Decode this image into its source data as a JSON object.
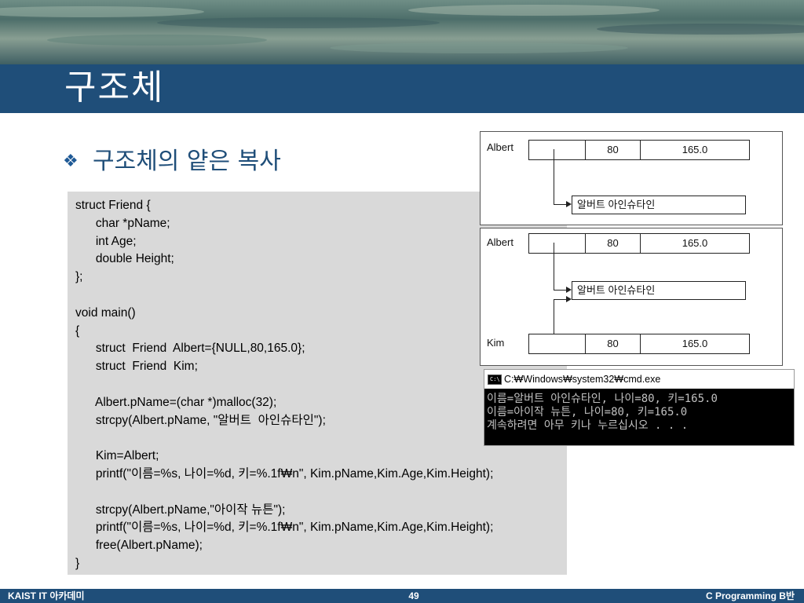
{
  "slide": {
    "title": "구조체",
    "bullet_symbol": "❖",
    "subtitle": "구조체의 얕은 복사"
  },
  "code": [
    "struct Friend {",
    "      char *pName;",
    "      int Age;",
    "      double Height;",
    "};",
    "",
    "void main()",
    "{",
    "      struct  Friend  Albert={NULL,80,165.0};",
    "      struct  Friend  Kim;",
    "",
    "      Albert.pName=(char *)malloc(32);",
    "      strcpy(Albert.pName, \"알버트  아인슈타인\");",
    "",
    "      Kim=Albert;",
    "      printf(\"이름=%s, 나이=%d, 키=%.1f₩n\", Kim.pName,Kim.Age,Kim.Height);",
    "",
    "      strcpy(Albert.pName,\"아이작 뉴튼\");",
    "      printf(\"이름=%s, 나이=%d, 키=%.1f₩n\", Kim.pName,Kim.Age,Kim.Height);",
    "      free(Albert.pName);",
    "}"
  ],
  "diagram1": {
    "var_label": "Albert",
    "age": "80",
    "height": "165.0",
    "name_value": "알버트 아인슈타인"
  },
  "diagram2": {
    "var1_label": "Albert",
    "var1_age": "80",
    "var1_height": "165.0",
    "name_value": "알버트 아인슈타인",
    "var2_label": "Kim",
    "var2_age": "80",
    "var2_height": "165.0"
  },
  "console": {
    "icon_label": "C:\\",
    "title": "C:₩Windows₩system32₩cmd.exe",
    "lines": [
      "이름=알버트 아인슈타인, 나이=80, 키=165.0",
      "이름=아이작 뉴튼, 나이=80, 키=165.0",
      "계속하려면 아무 키나 누르십시오 . . ."
    ]
  },
  "footer": {
    "left": "KAIST IT 아카데미",
    "page": "49",
    "right": "C Programming B반"
  },
  "colors": {
    "title_bar": "#1f4e79",
    "subtitle": "#1f4e79",
    "code_background": "#d9d9d9",
    "console_background": "#000000"
  }
}
